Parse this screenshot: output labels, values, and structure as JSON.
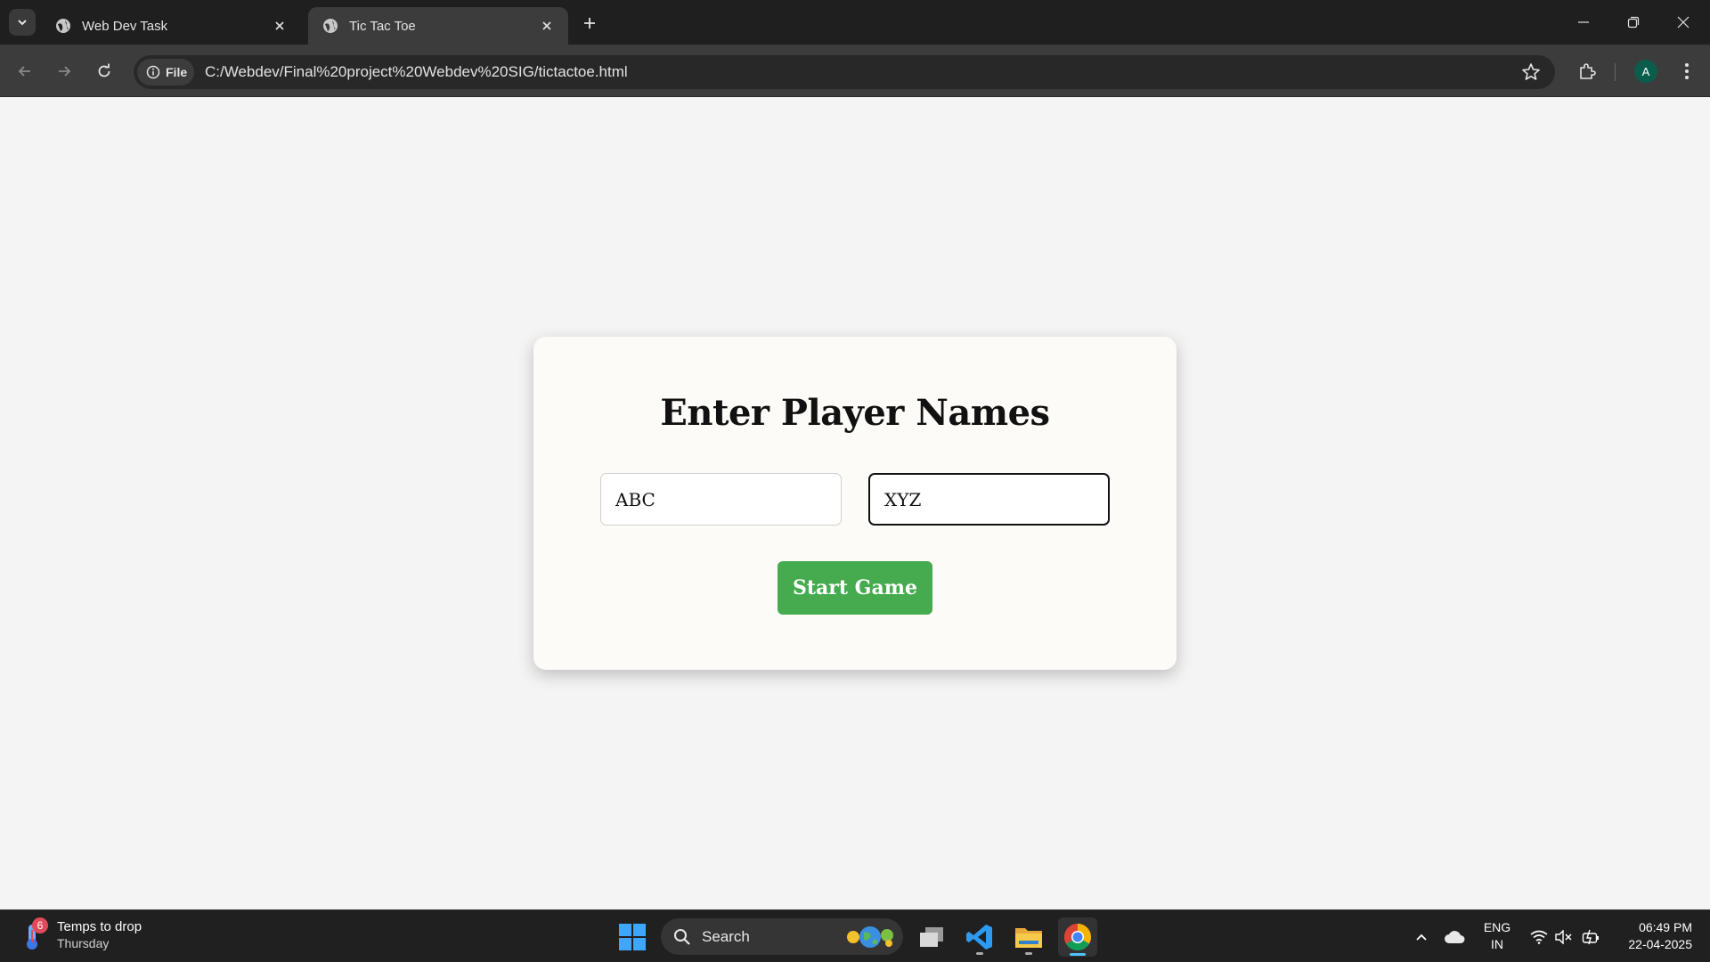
{
  "browser": {
    "tabs": [
      {
        "title": "Web Dev Task",
        "active": false
      },
      {
        "title": "Tic Tac Toe",
        "active": true
      }
    ],
    "address": {
      "chip_label": "File",
      "url": "C:/Webdev/Final%20project%20Webdev%20SIG/tictactoe.html"
    },
    "profile_initial": "A"
  },
  "page": {
    "heading": "Enter Player Names",
    "player1": {
      "value": "ABC"
    },
    "player2": {
      "value": "XYZ"
    },
    "start_label": "Start Game"
  },
  "taskbar": {
    "weather": {
      "headline": "Temps to drop",
      "day": "Thursday",
      "badge": "6"
    },
    "search_label": "Search",
    "lang_top": "ENG",
    "lang_bottom": "IN",
    "time": "06:49 PM",
    "date": "22-04-2025"
  },
  "colors": {
    "start_button": "#46ab4e",
    "card_background": "#fcfbf8",
    "page_background": "#f4f4f4",
    "chrome_dark": "#1f1f1f"
  },
  "icons": [
    "tab-search-icon",
    "globe-icon",
    "close-icon",
    "plus-icon",
    "minimize-icon",
    "restore-icon",
    "back-icon",
    "forward-icon",
    "reload-icon",
    "info-icon",
    "star-icon",
    "extensions-icon",
    "menu-icon",
    "thermometer-icon",
    "windows-icon",
    "search-icon",
    "task-view-icon",
    "vscode-icon",
    "folder-icon",
    "chrome-icon",
    "chevron-up-icon",
    "cloud-icon",
    "wifi-icon",
    "mute-icon",
    "battery-icon"
  ]
}
